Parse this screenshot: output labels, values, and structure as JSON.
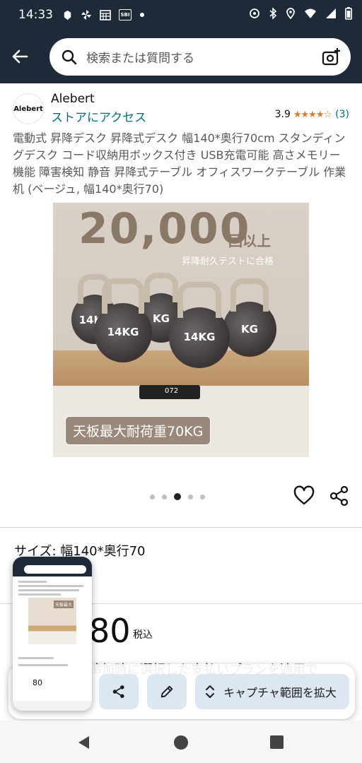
{
  "status_bar": {
    "time": "14:33",
    "left_icons": [
      "app-icon",
      "pinwheel-icon",
      "calendar-icon",
      "sbi-icon"
    ],
    "sbi_label": "SBI",
    "right_icons": [
      "location-off-icon",
      "bluetooth-icon",
      "location-icon",
      "wifi-icon",
      "signal-icon",
      "battery-icon"
    ]
  },
  "search": {
    "placeholder": "検索または質問する"
  },
  "brand": {
    "logo_text": "Alebert",
    "name": "Alebert",
    "store_link": "ストアにアクセス"
  },
  "rating": {
    "score": "3.9",
    "stars": 3.9,
    "count": "(3)"
  },
  "product": {
    "title": "電動式 昇降デスク 昇降式デスク 幅140*奥行70cm スタンディングデスク コード収納用ボックス付き USB充電可能 高さメモリー機能 障害検知 静音 昇降式テーブル オフィスワークテーブル 作業机 (ベージュ, 幅140*奥行70)"
  },
  "image": {
    "headline_number": "20,000",
    "headline_suffix": "回以上",
    "subtext": "昇降耐久テストに合格",
    "kettlebell_label": "14KG",
    "kettlebell_label_short": "KG",
    "controller_display": "072",
    "badge": "天板最大耐荷重70KG",
    "carousel_count": 5,
    "carousel_active_index": 2
  },
  "size": {
    "label": "サイズ: 幅140*奥行70"
  },
  "price": {
    "value": "80",
    "tax_label": "税込",
    "partial_text": "追加時に選択した支払いプランを適用で"
  },
  "toolbar": {
    "share_icon": "share-icon",
    "edit_icon": "pencil-icon",
    "expand_label": "キャプチャ範囲を拡大"
  },
  "thumbnail": {
    "badge": "天板最大",
    "price": "80"
  },
  "colors": {
    "header_bg": "#1e2a38",
    "link": "#007185",
    "star": "#de7921",
    "toolbar_button": "#dce7f2"
  }
}
